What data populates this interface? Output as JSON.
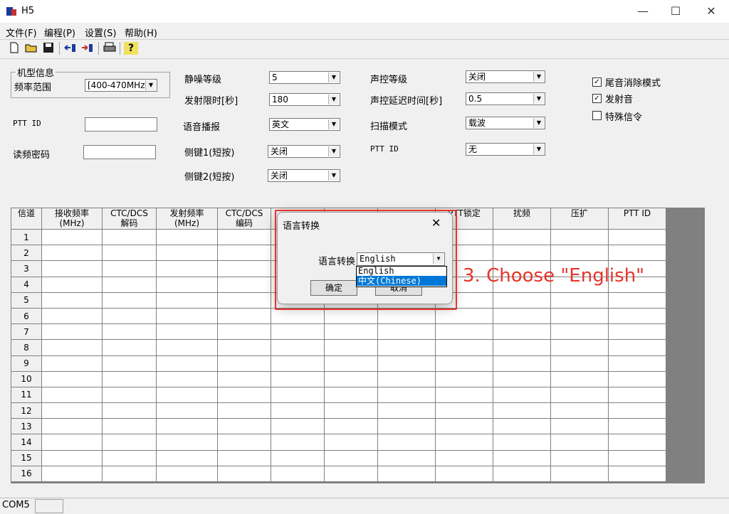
{
  "window": {
    "title": "H5",
    "minimize": "—",
    "maximize": "☐",
    "close": "✕"
  },
  "menu": [
    "文件(F)",
    "编程(P)",
    "设置(S)",
    "帮助(H)"
  ],
  "toolbar": [
    "new-file-icon",
    "open-folder-icon",
    "save-icon",
    "read-radio-icon",
    "write-radio-icon",
    "print-icon",
    "help-icon"
  ],
  "form": {
    "model_group_title": "机型信息",
    "freq_range_label": "频率范围",
    "freq_range_value": "[400-470MHz]",
    "ptt_id_label": "PTT ID",
    "read_pwd_label": "读频密码",
    "squelch_label": "静噪等级",
    "squelch_value": "5",
    "tx_limit_label": "发射限时[秒]",
    "tx_limit_value": "180",
    "voice_label": "语音播报",
    "voice_value": "英文",
    "side1_label": "侧键1(短按)",
    "side1_value": "关闭",
    "side2_label": "侧键2(短按)",
    "side2_value": "关闭",
    "vox_label": "声控等级",
    "vox_value": "关闭",
    "vox_delay_label": "声控延迟时间[秒]",
    "vox_delay_value": "0.5",
    "scan_label": "扫描模式",
    "scan_value": "载波",
    "ptt_id2_label": "PTT ID",
    "ptt_id2_value": "无",
    "tail_label": "尾音消除模式",
    "beep_label": "发射音",
    "special_label": "特殊信令"
  },
  "grid": {
    "headers": [
      "信道",
      "接收频率\n(MHz)",
      "CTC/DCS\n解码",
      "发射频率\n(MHz)",
      "CTC/DCS\n编码",
      "",
      "",
      "",
      "PTT锁定",
      "扰频",
      "压扩",
      "PTT ID"
    ],
    "rows": [
      "1",
      "2",
      "3",
      "4",
      "5",
      "6",
      "7",
      "8",
      "9",
      "10",
      "11",
      "12",
      "13",
      "14",
      "15",
      "16"
    ]
  },
  "status": {
    "port": "COM5"
  },
  "dialog": {
    "title": "语言转换",
    "label": "语言转换",
    "value": "English",
    "options": [
      "English",
      "中文(Chinese)"
    ],
    "ok": "确定",
    "cancel": "取消"
  },
  "annotation": "3. Choose \"English\"",
  "colors": {
    "highlight": "#0078d7",
    "annotation": "#e8342a"
  }
}
